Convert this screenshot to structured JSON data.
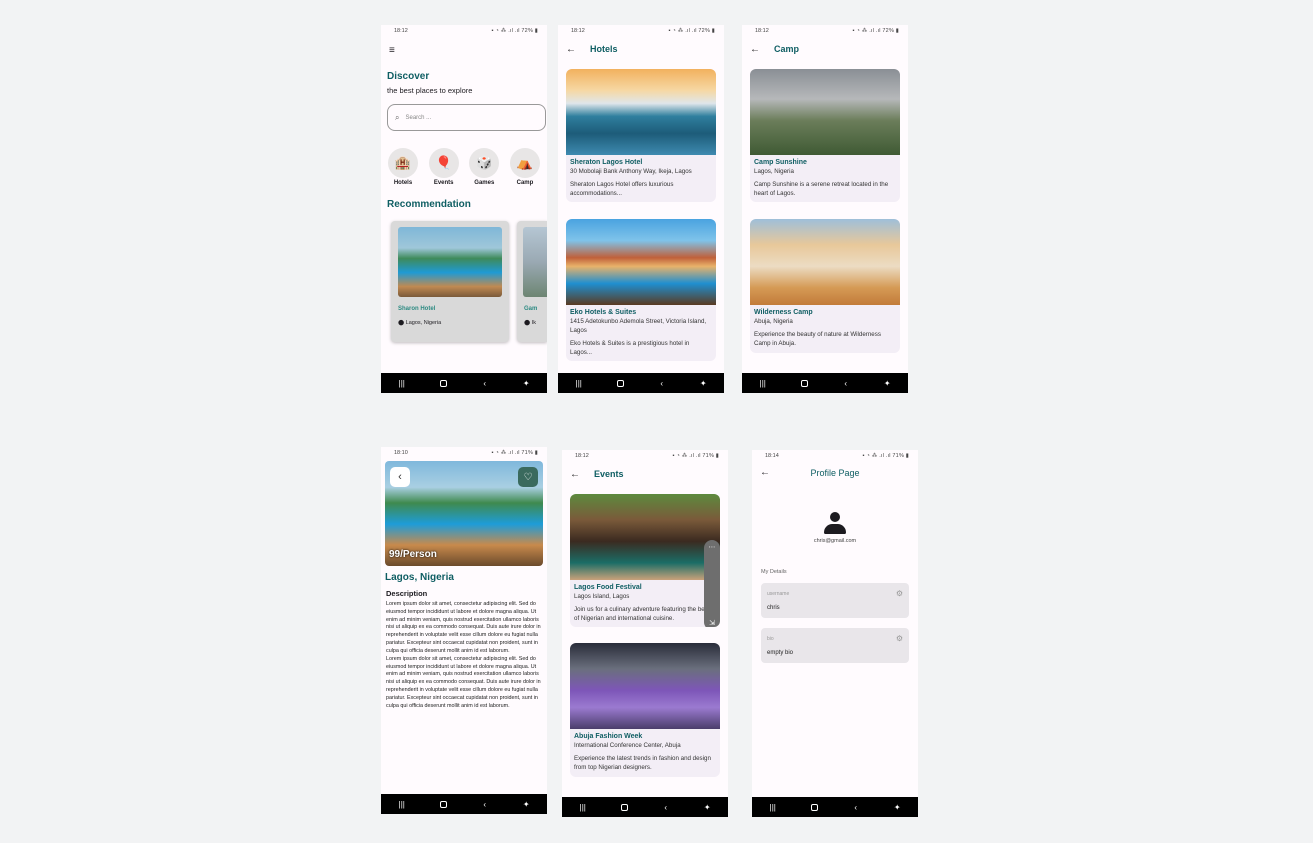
{
  "colors": {
    "teal": "#0f5e63",
    "nav": "#000000",
    "background": "#fffbfe"
  },
  "nav_icons": [
    "recent-apps-icon",
    "home-icon",
    "back-icon",
    "accessibility-icon"
  ],
  "screens": {
    "discover": {
      "time": "18:12",
      "battery": "72%",
      "title": "Discover",
      "subtitle": "the best places to explore",
      "search_placeholder": "Search ...",
      "categories": [
        {
          "label": "Hotels",
          "icon": "hotel-icon"
        },
        {
          "label": "Events",
          "icon": "balloon-icon"
        },
        {
          "label": "Games",
          "icon": "games-icon"
        },
        {
          "label": "Camp",
          "icon": "tent-icon"
        }
      ],
      "section": "Recommendation",
      "rec1": {
        "name": "Sharon Hotel",
        "location": "Lagos, Nigeria"
      },
      "rec2": {
        "name": "Gam",
        "location": "Ik"
      }
    },
    "hotels": {
      "time": "18:12",
      "battery": "72%",
      "title": "Hotels",
      "cards": [
        {
          "name": "Sheraton Lagos Hotel",
          "address": "30 Mobolaji Bank Anthony Way, Ikeja, Lagos",
          "desc": "Sheraton Lagos Hotel offers luxurious accommodations..."
        },
        {
          "name": "Eko Hotels & Suites",
          "address": "1415 Adetokunbo Ademola Street, Victoria Island, Lagos",
          "desc": "Eko Hotels & Suites is a prestigious hotel in Lagos..."
        }
      ]
    },
    "camp": {
      "time": "18:12",
      "battery": "72%",
      "title": "Camp",
      "cards": [
        {
          "name": "Camp Sunshine",
          "address": "Lagos, Nigeria",
          "desc": "Camp Sunshine is a serene retreat located in the heart of Lagos."
        },
        {
          "name": "Wilderness Camp",
          "address": "Abuja, Nigeria",
          "desc": "Experience the beauty of nature at Wilderness Camp in Abuja."
        }
      ]
    },
    "detail": {
      "time": "18:10",
      "battery": "71%",
      "price": "99/Person",
      "location": "Lagos, Nigeria",
      "desc_title": "Description",
      "lorem1": "Lorem ipsum dolor sit amet, consectetur adipiscing elit. Sed do eiusmod tempor incididunt ut labore et dolore magna aliqua. Ut enim ad minim veniam, quis nostrud exercitation ullamco laboris nisi ut aliquip ex ea commodo consequat. Duis aute irure dolor in reprehenderit in voluptate velit esse cillum dolore eu fugiat nulla pariatur. Excepteur sint occaecat cupidatat non proident, sunt in culpa qui officia deserunt mollit anim id est laborum.",
      "lorem2": "Lorem ipsum dolor sit amet, consectetur adipiscing elit. Sed do eiusmod tempor incididunt ut labore et dolore magna aliqua. Ut enim ad minim veniam, quis nostrud exercitation ullamco laboris nisi ut aliquip ex ea commodo consequat. Duis aute irure dolor in reprehenderit in voluptate velit esse cillum dolore eu fugiat nulla pariatur. Excepteur sint occaecat cupidatat non proident, sunt in culpa qui officia deserunt mollit anim id est laborum."
    },
    "events": {
      "time": "18:12",
      "battery": "71%",
      "title": "Events",
      "cards": [
        {
          "name": "Lagos Food Festival",
          "address": "Lagos Island, Lagos",
          "desc": "Join us for a culinary adventure featuring the best of Nigerian and international cuisine."
        },
        {
          "name": "Abuja Fashion Week",
          "address": "International Conference Center, Abuja",
          "desc": "Experience the latest trends in fashion and design from top Nigerian designers."
        }
      ]
    },
    "profile": {
      "time": "18:14",
      "battery": "71%",
      "title": "Profile Page",
      "email": "chris@gmail.com",
      "section": "My Details",
      "username_label": "username",
      "username": "chris",
      "bio_label": "bio",
      "bio": "empty bio"
    }
  }
}
